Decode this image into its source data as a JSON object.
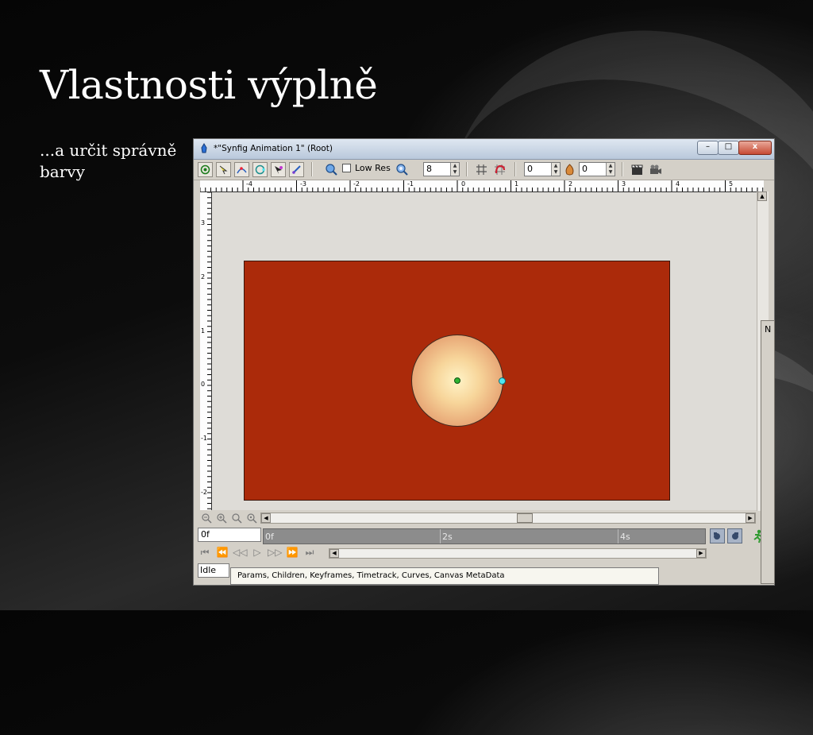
{
  "slide": {
    "title": "Vlastnosti výplně",
    "body": "...a určit správně barvy"
  },
  "window": {
    "title": "*\"Synfig Animation 1\" (Root)",
    "controls": {
      "minimize": "–",
      "maximize": "□",
      "close": "x"
    }
  },
  "toolbar": {
    "low_res_label": "Low Res",
    "low_res_checked": false,
    "quality_value": "8",
    "onion_past_value": "0",
    "onion_future_value": "0"
  },
  "rulers": {
    "horizontal_labels": [
      "-4",
      "-3",
      "-2",
      "-1",
      "0",
      "1",
      "2",
      "3",
      "4",
      "5"
    ],
    "vertical_labels": [
      "3",
      "2",
      "1",
      "0",
      "-1",
      "-2"
    ]
  },
  "canvas": {
    "background_color": "#ab2a0a",
    "circle_center_color": "#fff3c7",
    "circle_outer_color": "#d18868"
  },
  "timebar": {
    "current_frame": "0f",
    "labels": [
      "0f",
      "2s",
      "4s"
    ]
  },
  "status": {
    "text": "Idle"
  },
  "tooltip": {
    "text": "Params, Children, Keyframes, Timetrack, Curves, Canvas MetaData"
  },
  "side_panel": {
    "label": "N"
  }
}
